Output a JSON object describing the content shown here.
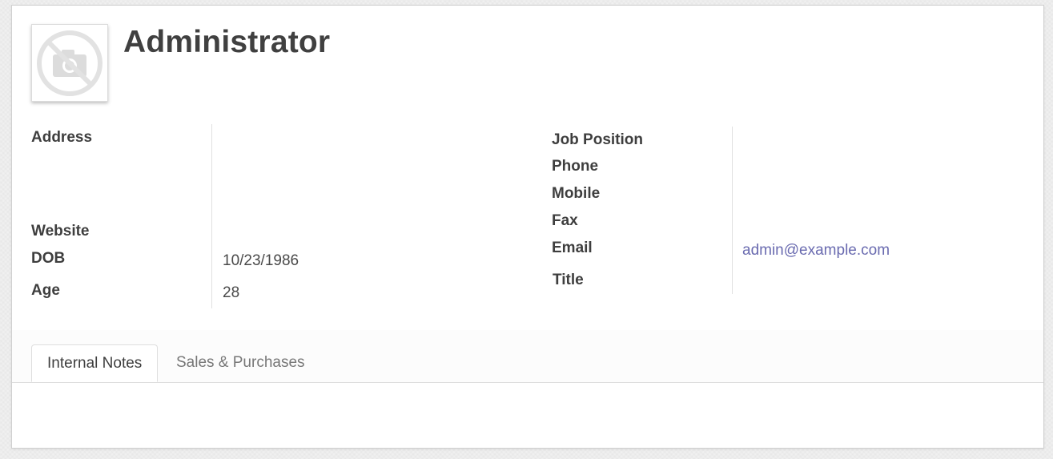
{
  "partner": {
    "name": "Administrator"
  },
  "left_fields": {
    "address_label": "Address",
    "website_label": "Website",
    "dob_label": "DOB",
    "dob_value": "10/23/1986",
    "age_label": "Age",
    "age_value": "28"
  },
  "right_fields": {
    "job_position_label": "Job Position",
    "phone_label": "Phone",
    "mobile_label": "Mobile",
    "fax_label": "Fax",
    "email_label": "Email",
    "email_value": "admin@example.com",
    "title_label": "Title"
  },
  "tabs": [
    {
      "label": "Internal Notes",
      "active": true
    },
    {
      "label": "Sales & Purchases",
      "active": false
    }
  ],
  "colors": {
    "link": "#6a6bb0",
    "heading": "#404040"
  },
  "icons": {
    "avatar_placeholder": "no-photo-icon"
  }
}
